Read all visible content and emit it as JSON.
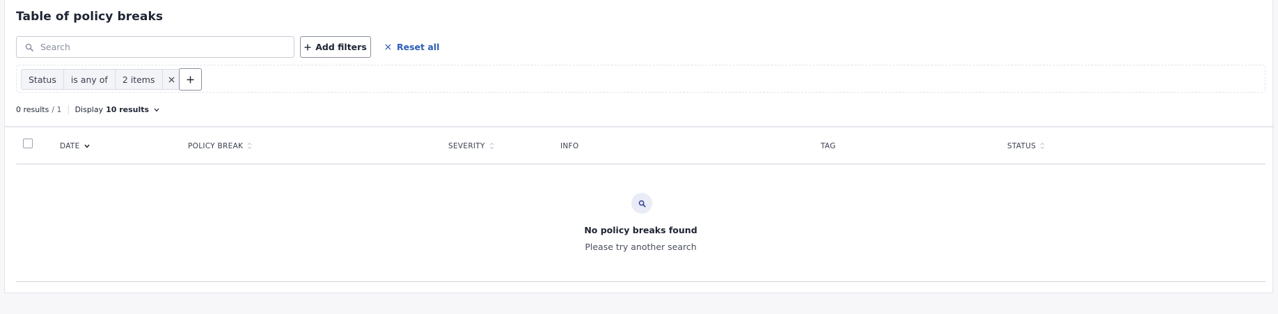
{
  "page": {
    "title": "Table of policy breaks"
  },
  "toolbar": {
    "search_placeholder": "Search",
    "search_value": "",
    "add_filters_label": "Add filters",
    "reset_label": "Reset all"
  },
  "filter_chip": {
    "field": "Status",
    "operator": "is any of",
    "value": "2 items"
  },
  "results": {
    "count": "0 results",
    "pages": "/ 1",
    "display_label": "Display",
    "display_value": "10 results"
  },
  "table": {
    "columns": [
      {
        "label": "DATE",
        "sort": "desc"
      },
      {
        "label": "POLICY BREAK",
        "sort": "none"
      },
      {
        "label": "SEVERITY",
        "sort": "none"
      },
      {
        "label": "INFO",
        "sort": null
      },
      {
        "label": "TAG",
        "sort": null
      },
      {
        "label": "STATUS",
        "sort": "none"
      }
    ],
    "rows": []
  },
  "empty_state": {
    "icon": "search-icon",
    "title": "No policy breaks found",
    "subtitle": "Please try another search"
  },
  "colors": {
    "accent": "#2c5db5",
    "background": "#f7f7fa",
    "text": "#1f2433"
  }
}
